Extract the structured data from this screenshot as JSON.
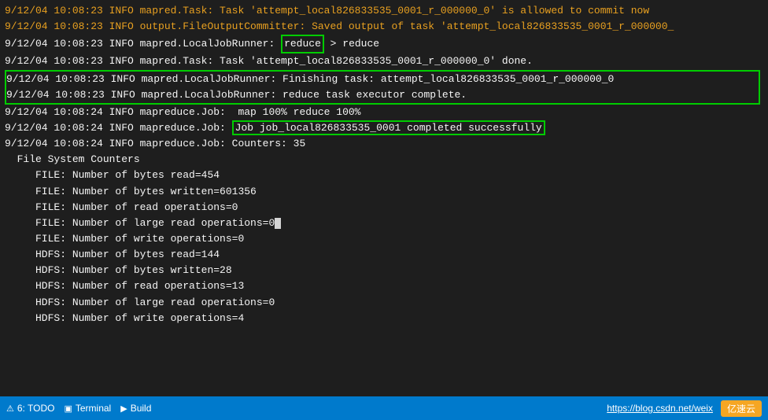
{
  "terminal": {
    "lines": [
      {
        "id": "line1",
        "text": "9/12/04 10:08:23 INFO mapred.Task: Task 'attempt_local826833535_0001_r_000000_0' is allowed to commit now",
        "style": "orange"
      },
      {
        "id": "line2",
        "text": "9/12/04 10:08:23 INFO output.FileOutputCommitter: Saved output of task 'attempt_local826833535_0001_r_000000_",
        "style": "orange"
      },
      {
        "id": "line3",
        "text": "9/12/04 10:08:23 INFO mapred.LocalJobRunner: reduce > reduce",
        "style": "normal"
      },
      {
        "id": "line4",
        "text": "9/12/04 10:08:23 INFO mapred.Task: Task 'attempt_local826833535_0001_r_000000_0' done.",
        "style": "normal"
      },
      {
        "id": "line5",
        "text": "9/12/04 10:08:23 INFO mapred.LocalJobRunner: Finishing task: attempt_local826833535_0001_r_000000_0",
        "style": "greenbox"
      },
      {
        "id": "line6",
        "text": "9/12/04 10:08:23 INFO mapred.LocalJobRunner: reduce task executor complete.",
        "style": "greenbox2"
      },
      {
        "id": "line7",
        "text": "9/12/04 10:08:24 INFO mapreduce.Job:  map 100% reduce 100%",
        "style": "normal"
      },
      {
        "id": "line8",
        "text": "9/12/04 10:08:24 INFO mapreduce.Job: Job job_local826833535_0001 completed successfully",
        "style": "successbox"
      },
      {
        "id": "line9",
        "text": "9/12/04 10:08:24 INFO mapreduce.Job: Counters: 35",
        "style": "normal"
      },
      {
        "id": "line10",
        "text": "  File System Counters",
        "style": "normal"
      },
      {
        "id": "line11",
        "text": "     FILE: Number of bytes read=454",
        "style": "normal"
      },
      {
        "id": "line12",
        "text": "     FILE: Number of bytes written=601356",
        "style": "normal"
      },
      {
        "id": "line13",
        "text": "     FILE: Number of read operations=0",
        "style": "normal"
      },
      {
        "id": "line14",
        "text": "     FILE: Number of large read operations=0",
        "style": "cursor"
      },
      {
        "id": "line15",
        "text": "     FILE: Number of write operations=0",
        "style": "normal"
      },
      {
        "id": "line16",
        "text": "     HDFS: Number of bytes read=144",
        "style": "normal"
      },
      {
        "id": "line17",
        "text": "     HDFS: Number of bytes written=28",
        "style": "normal"
      },
      {
        "id": "line18",
        "text": "     HDFS: Number of read operations=13",
        "style": "normal"
      },
      {
        "id": "line19",
        "text": "     HDFS: Number of large read operations=0",
        "style": "normal"
      },
      {
        "id": "line20",
        "text": "     HDFS: Number of write operations=4",
        "style": "normal"
      }
    ]
  },
  "statusbar": {
    "items": [
      {
        "id": "errors",
        "icon": "⚠",
        "label": "6: TODO"
      },
      {
        "id": "terminal",
        "icon": "▣",
        "label": "Terminal"
      },
      {
        "id": "build",
        "icon": "▶",
        "label": "Build"
      }
    ],
    "link": "https://blog.csdn.net/weix",
    "brand": "亿速云"
  },
  "highlight": {
    "reduce_word": "reduce",
    "success_text": "Job job_local826833535_0001 completed successfully"
  }
}
